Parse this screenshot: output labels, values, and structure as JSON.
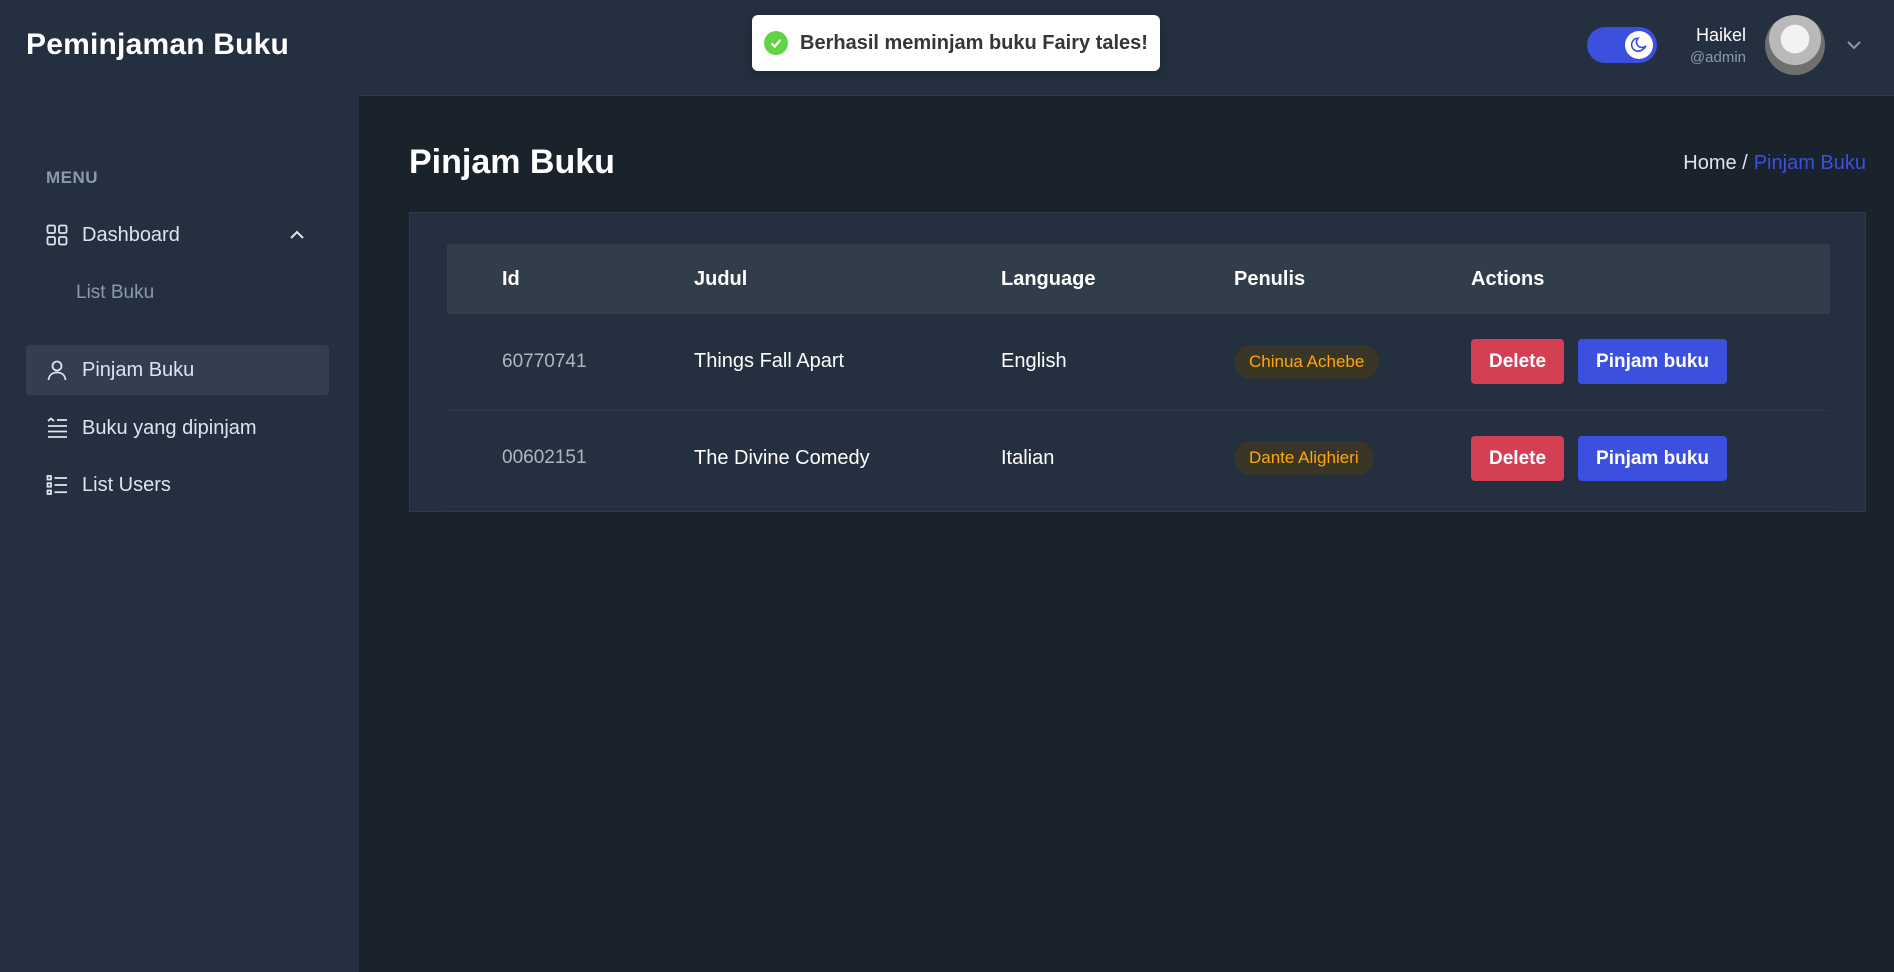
{
  "app": {
    "brand": "Peminjaman Buku"
  },
  "sidebar": {
    "menu_heading": "MENU",
    "items": [
      {
        "label": "Dashboard",
        "icon": "grid-icon",
        "expanded": true
      },
      {
        "label": "Pinjam Buku",
        "icon": "user-icon",
        "active": true
      },
      {
        "label": "Buku yang dipinjam",
        "icon": "text-align-icon"
      },
      {
        "label": "List Users",
        "icon": "list-icon"
      }
    ],
    "subitems": [
      {
        "label": "List Buku"
      }
    ]
  },
  "toast": {
    "message": "Berhasil meminjam buku Fairy tales!",
    "status_color": "#61d345"
  },
  "header": {
    "dark_mode": true,
    "user": {
      "name": "Haikel",
      "role": "@admin"
    }
  },
  "main": {
    "title": "Pinjam Buku",
    "breadcrumb": {
      "home": "Home /",
      "current": "Pinjam Buku"
    },
    "table": {
      "columns": [
        "Id",
        "Judul",
        "Language",
        "Penulis",
        "Actions"
      ],
      "rows": [
        {
          "id": "60770741",
          "judul": "Things Fall Apart",
          "language": "English",
          "penulis": "Chinua Achebe"
        },
        {
          "id": "00602151",
          "judul": "The Divine Comedy",
          "language": "Italian",
          "penulis": "Dante Alighieri"
        }
      ],
      "delete_label": "Delete",
      "pinjam_label": "Pinjam buku"
    }
  },
  "colors": {
    "primary": "#3c50e0",
    "danger": "#d34053",
    "warning": "#ffa70b"
  }
}
